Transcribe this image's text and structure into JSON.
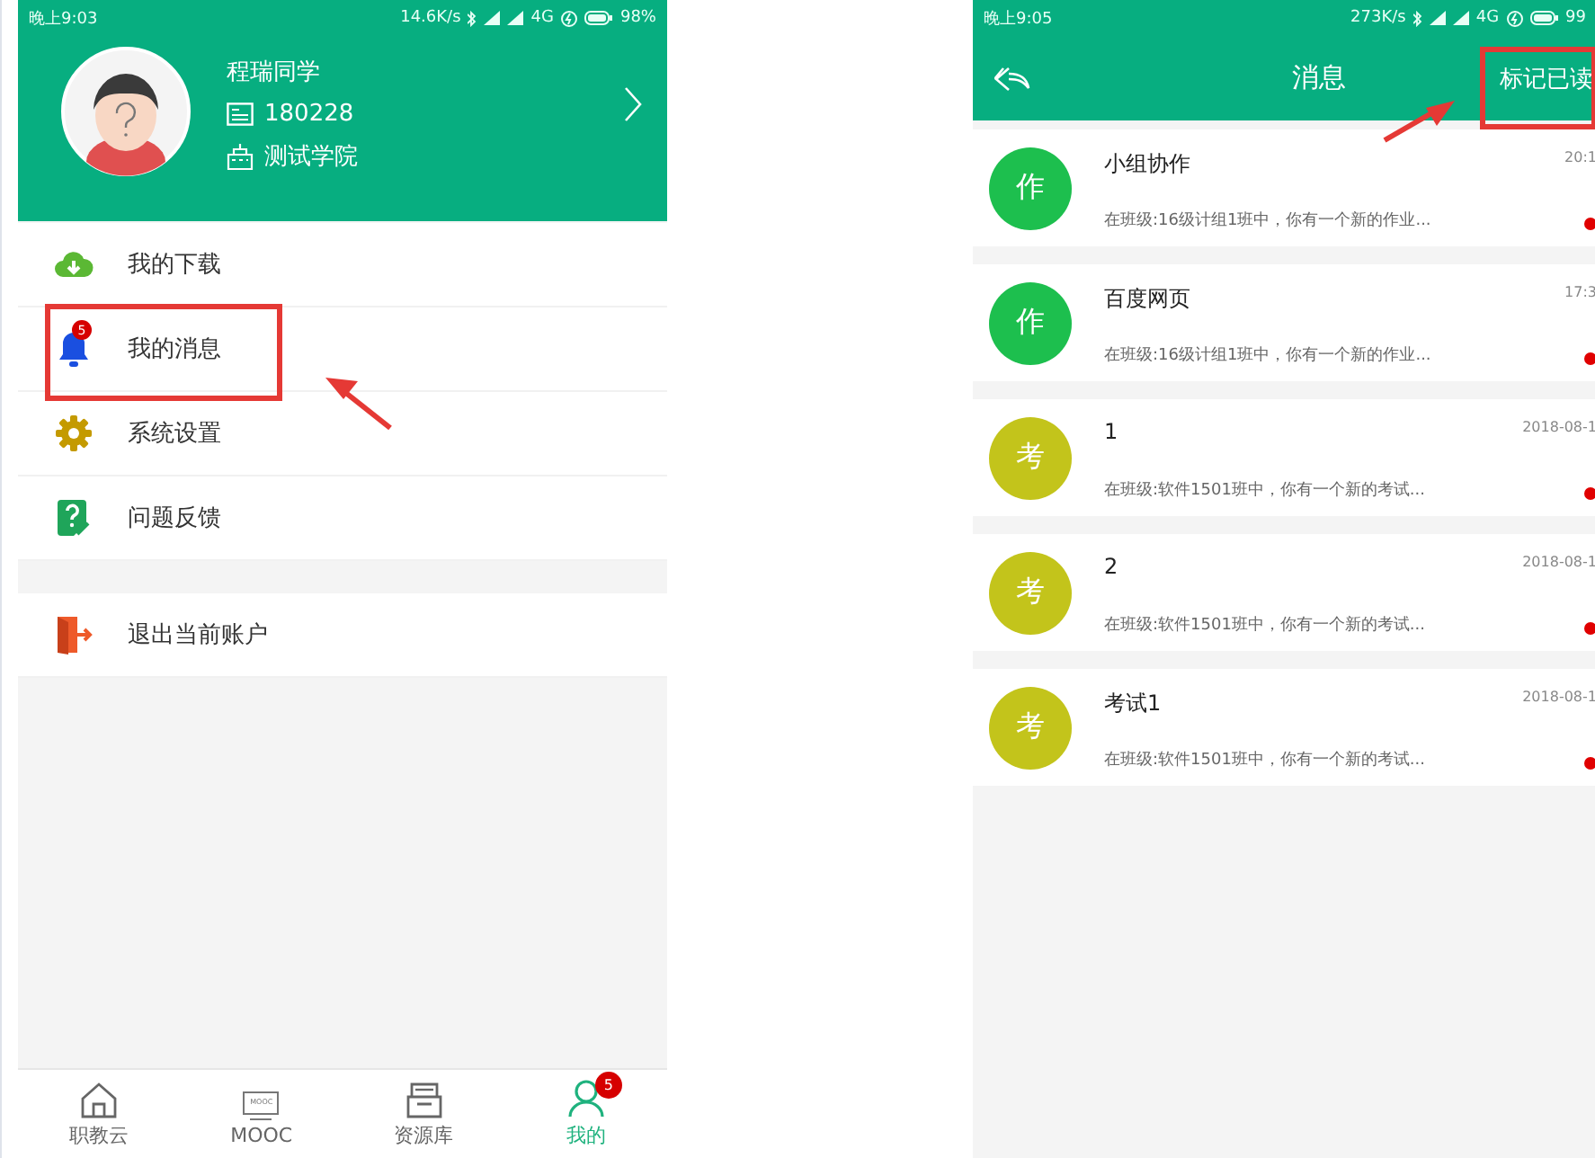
{
  "profile_screen": {
    "status_bar": {
      "time": "晚上9:03",
      "speed": "14.6K/s",
      "network": "4G",
      "battery": "98%"
    },
    "profile": {
      "name": "程瑞同学",
      "id": "180228",
      "school": "测试学院"
    },
    "menu_groups": [
      [
        {
          "kind": "download",
          "label": "我的下载"
        },
        {
          "kind": "messages",
          "label": "我的消息",
          "badge": "5"
        },
        {
          "kind": "settings",
          "label": "系统设置"
        },
        {
          "kind": "feedback",
          "label": "问题反馈"
        }
      ],
      [
        {
          "kind": "logout",
          "label": "退出当前账户"
        }
      ]
    ],
    "tabs": [
      {
        "kind": "home",
        "label": "职教云",
        "selected": false
      },
      {
        "kind": "mooc",
        "label": "MOOC",
        "icon_text": "MOOC",
        "selected": false
      },
      {
        "kind": "library",
        "label": "资源库",
        "selected": false
      },
      {
        "kind": "me",
        "label": "我的",
        "badge": "5",
        "selected": true
      }
    ]
  },
  "message_screen": {
    "status_bar": {
      "time": "晚上9:05",
      "speed": "273K/s",
      "network": "4G",
      "battery": "99"
    },
    "title": "消息",
    "action": "标记已读",
    "messages": [
      {
        "avatar": "作",
        "color": "#1dbf4e",
        "title": "小组协作",
        "time": "20:1",
        "preview": "在班级:16级计组1班中，你有一个新的作业...",
        "unread": true
      },
      {
        "avatar": "作",
        "color": "#1dbf4e",
        "title": "百度网页",
        "time": "17:3",
        "preview": "在班级:16级计组1班中，你有一个新的作业...",
        "unread": true
      },
      {
        "avatar": "考",
        "color": "#c3c41b",
        "title": "1",
        "time": "2018-08-1",
        "preview": "在班级:软件1501班中，你有一个新的考试...",
        "unread": true
      },
      {
        "avatar": "考",
        "color": "#c3c41b",
        "title": "2",
        "time": "2018-08-1",
        "preview": "在班级:软件1501班中，你有一个新的考试...",
        "unread": true
      },
      {
        "avatar": "考",
        "color": "#c3c41b",
        "title": "考试1",
        "time": "2018-08-1",
        "preview": "在班级:软件1501班中，你有一个新的考试...",
        "unread": true
      }
    ]
  }
}
